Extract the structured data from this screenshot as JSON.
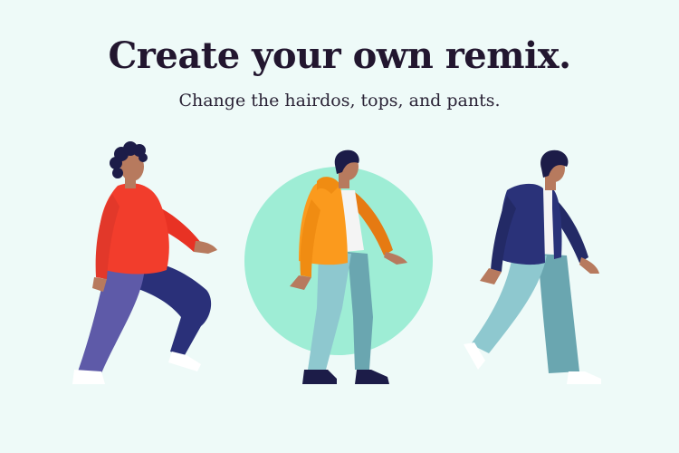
{
  "hero": {
    "title": "Create your own remix.",
    "subtitle": "Change the hairdos, tops, and pants."
  },
  "colors": {
    "background": "#eefaf8",
    "title_text": "#22162f",
    "circle_accent": "#9eedd5",
    "skin": "#b77a5e",
    "hair": "#1c1c48",
    "red_sweater": "#f23d2c",
    "orange_hoodie": "#fb9a1d",
    "navy_jacket": "#2a3279",
    "purple_pants": "#5e5aa8",
    "navy_pants": "#2a3079",
    "teal_pants": "#8ec8cf"
  },
  "figures": [
    {
      "name": "walker-red-sweater"
    },
    {
      "name": "walker-orange-hoodie"
    },
    {
      "name": "walker-navy-jacket"
    }
  ]
}
